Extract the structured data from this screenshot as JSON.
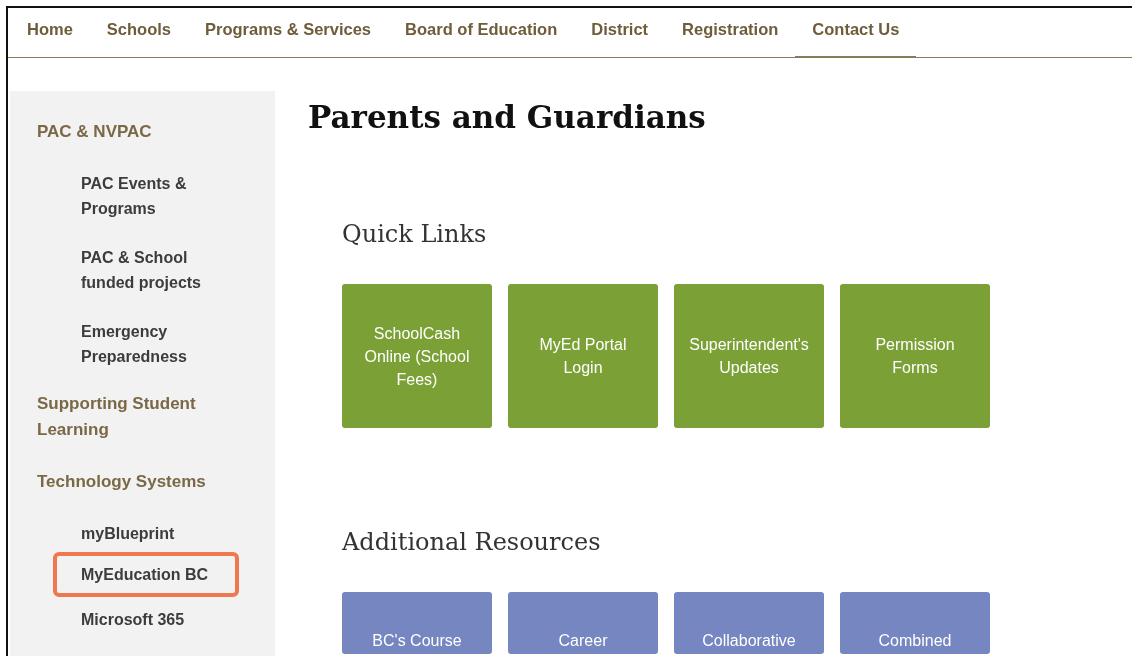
{
  "nav": [
    {
      "label": "Home",
      "selected": false
    },
    {
      "label": "Schools",
      "selected": false
    },
    {
      "label": "Programs & Services",
      "selected": false
    },
    {
      "label": "Board of Education",
      "selected": false
    },
    {
      "label": "District",
      "selected": false
    },
    {
      "label": "Registration",
      "selected": false
    },
    {
      "label": "Contact Us",
      "selected": true
    }
  ],
  "sidebar": {
    "items": [
      {
        "label": "PAC & NVPAC",
        "highlighted": false,
        "children": [
          {
            "label": "PAC Events & Programs",
            "highlighted": false
          },
          {
            "label": "PAC & School funded projects",
            "highlighted": false
          },
          {
            "label": "Emergency Preparedness",
            "highlighted": false
          }
        ]
      },
      {
        "label": "Supporting Student Learning",
        "highlighted": false
      },
      {
        "label": "Technology Systems",
        "highlighted": false,
        "children": [
          {
            "label": "myBlueprint",
            "highlighted": false
          },
          {
            "label": "MyEducation BC",
            "highlighted": true
          },
          {
            "label": "Microsoft 365",
            "highlighted": false
          }
        ]
      }
    ]
  },
  "page_title": "Parents and Guardians",
  "sections": [
    {
      "title": "Quick Links",
      "color": "#7ba136",
      "tiles": [
        "SchoolCash Online (School Fees)",
        "MyEd Portal Login",
        "Superintendent's Updates",
        "Permission Forms"
      ]
    },
    {
      "title": "Additional Resources",
      "color": "#7586c1",
      "tiles": [
        "BC's Course",
        "Career",
        "Collaborative",
        "Combined"
      ]
    }
  ]
}
